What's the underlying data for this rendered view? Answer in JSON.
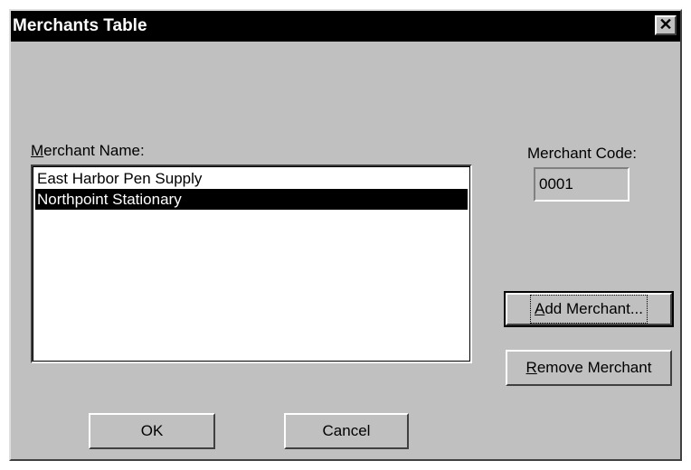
{
  "window": {
    "title": "Merchants Table",
    "close_glyph": "✕"
  },
  "merchant_name": {
    "label_first": "M",
    "label_rest": "erchant Name:",
    "items": [
      {
        "label": "East Harbor Pen Supply",
        "selected": false
      },
      {
        "label": "Northpoint Stationary",
        "selected": true
      }
    ]
  },
  "merchant_code": {
    "label": "Merchant Code:",
    "value": "0001"
  },
  "buttons": {
    "add_first": "A",
    "add_rest": "dd Merchant...",
    "remove_first": "R",
    "remove_rest": "emove Merchant",
    "ok": "OK",
    "cancel": "Cancel"
  }
}
